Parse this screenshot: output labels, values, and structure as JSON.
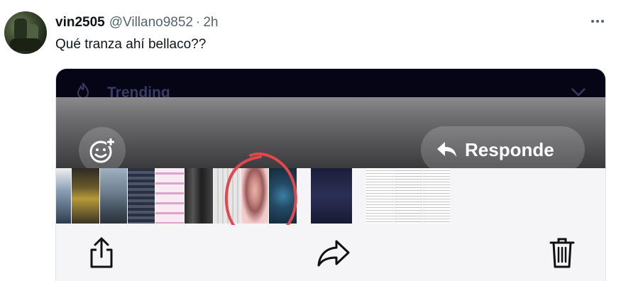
{
  "tweet": {
    "display_name": "vin2505",
    "handle": "@Villano9852",
    "separator": "·",
    "time": "2h",
    "text": "Qué tranza ahí bellaco??",
    "more_icon": "more-horizontal-icon"
  },
  "screenshot": {
    "banner_label": "Trending",
    "banner_icon": "flame-icon",
    "close_icon": "chevron-down-icon",
    "emoji_icon": "add-reaction-icon",
    "reply_label": "Responde",
    "reply_icon": "reply-arrow-icon",
    "actions": [
      {
        "name": "share-icon"
      },
      {
        "name": "forward-icon"
      },
      {
        "name": "trash-icon"
      }
    ],
    "colors": {
      "highlight_circle": "#e0474f",
      "top_strip": "#060516",
      "action_bar": "#f5f5f7"
    }
  }
}
